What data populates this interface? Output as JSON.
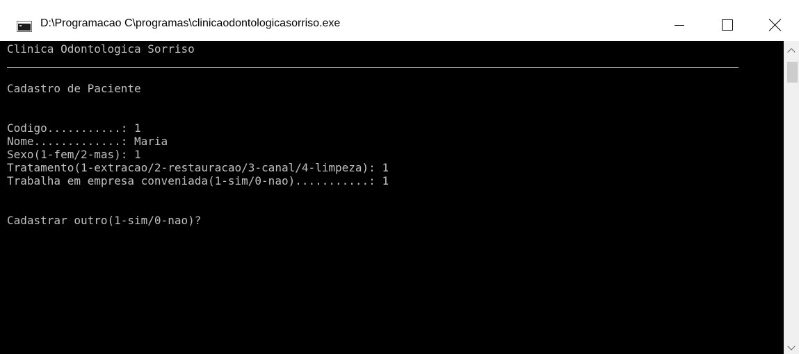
{
  "window": {
    "title": "D:\\Programacao C\\programas\\clinicaodontologicasorriso.exe",
    "icon": "console-app-icon",
    "controls": {
      "minimize_icon": "minimize-icon",
      "maximize_icon": "maximize-icon",
      "close_icon": "close-icon"
    }
  },
  "console": {
    "header": "Clinica Odontologica Sorriso",
    "section_title": "Cadastro de Paciente",
    "fields": [
      "Codigo...........: 1",
      "Nome.............: Maria",
      "Sexo(1-fem/2-mas): 1",
      "Tratamento(1-extracao/2-restauracao/3-canal/4-limpeza): 1",
      "Trabalha em empresa conveniada(1-sim/0-nao)...........: 1"
    ],
    "prompt": "Cadastrar outro(1-sim/0-nao)?"
  },
  "colors": {
    "console_background": "#000000",
    "console_text": "#c0c0c0",
    "titlebar_background": "#ffffff",
    "scrollbar_track": "#f0f0f0",
    "scrollbar_thumb": "#cdcdcd"
  }
}
